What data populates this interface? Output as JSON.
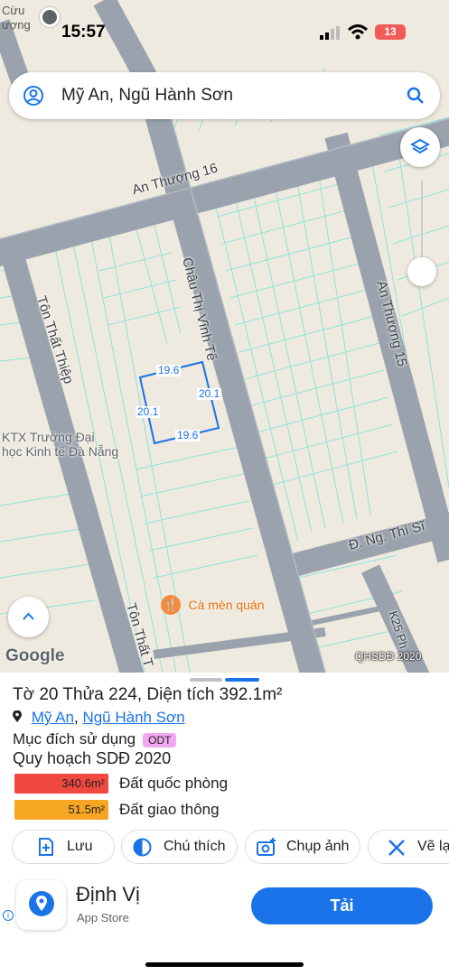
{
  "status_bar": {
    "back_label": "Cừu\nượng",
    "time": "15:57",
    "battery": "13"
  },
  "search": {
    "query": "Mỹ An, Ngũ Hành Sơn"
  },
  "map": {
    "roads": {
      "an_thuong_16": "An Thượng 16",
      "chau_thi_vinh_te": "Châu Thị Vĩnh Tế",
      "an_thuong_15": "An Thượng 15",
      "ton_that_thiep_top": "Tôn Thất Thiệp",
      "ton_that_thiep_bottom": "Tôn Thất T",
      "ng_thi_si": "Đ. Ng. Thì Sĩ",
      "k25": "K25 Ph"
    },
    "places": {
      "ktx_line1": "KTX Trường Đại",
      "ktx_line2": "học Kinh tế Đà Nẵng",
      "restaurant": "Cà mèn quán"
    },
    "parcel_dims": {
      "top": "19.6",
      "right": "20.1",
      "left": "20.1",
      "bottom": "19.6"
    },
    "google": "Google",
    "overlay": "QHSDĐ 2020",
    "colors": {
      "road": "#9aa3ad",
      "lot_line": "#7ee6d9",
      "parcel": "#1a73e8"
    }
  },
  "sheet": {
    "title": "Tờ 20 Thửa 224, Diện tích 392.1m²",
    "loc_ward": "Mỹ An",
    "loc_sep": ", ",
    "loc_district": "Ngũ Hành Sơn",
    "purpose_label": "Mục đích sử dụng",
    "purpose_code": "ODT",
    "plan_title": "Quy hoạch SDĐ 2020",
    "landuse": [
      {
        "area": "340.6m²",
        "label": "Đất quốc phòng",
        "color": "#f1483f"
      },
      {
        "area": "51.5m²",
        "label": "Đất giao thông",
        "color": "#f6a623"
      }
    ],
    "actions": [
      "Lưu",
      "Chú thích",
      "Chụp ảnh",
      "Vẽ lạ"
    ]
  },
  "ad": {
    "name": "Định Vị",
    "store": "App Store",
    "install": "Tải"
  }
}
